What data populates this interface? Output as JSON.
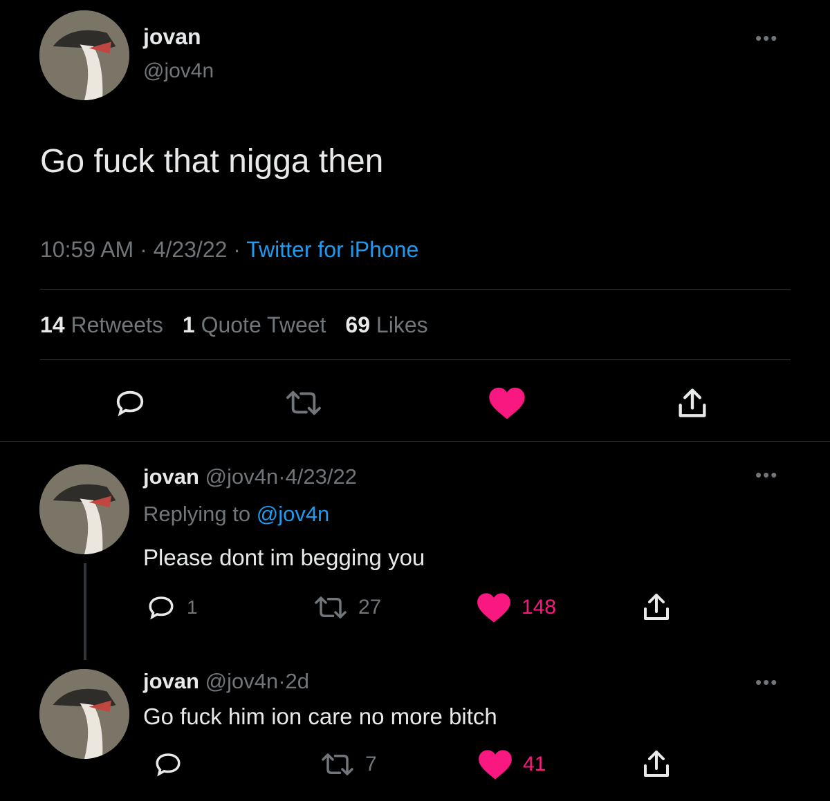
{
  "main_tweet": {
    "display_name": "jovan",
    "handle": "@jov4n",
    "text": "Go fuck that nigga then",
    "time": "10:59 AM",
    "date": "4/23/22",
    "source": "Twitter for iPhone",
    "stats": {
      "retweets_count": "14",
      "retweets_label": "Retweets",
      "quotes_count": "1",
      "quotes_label": "Quote Tweet",
      "likes_count": "69",
      "likes_label": "Likes"
    }
  },
  "reply_1": {
    "display_name": "jovan",
    "handle": "@jov4n",
    "date": "4/23/22",
    "replying_label": "Replying to",
    "replying_to": "@jov4n",
    "text": "Please dont im begging you",
    "replies": "1",
    "retweets": "27",
    "likes": "148"
  },
  "reply_2": {
    "display_name": "jovan",
    "handle": "@jov4n",
    "date": "2d",
    "text": "Go fuck him ion care no more bitch",
    "retweets": "7",
    "likes": "41"
  },
  "separators": {
    "dot": "·"
  },
  "icons": {
    "more": "more-dots-icon",
    "reply": "reply-icon",
    "retweet": "retweet-icon",
    "like": "heart-icon",
    "share": "share-icon"
  },
  "colors": {
    "background": "#000000",
    "text": "#e7e9ea",
    "muted": "#71767b",
    "link": "#1d9bf0",
    "like": "#f91880"
  }
}
